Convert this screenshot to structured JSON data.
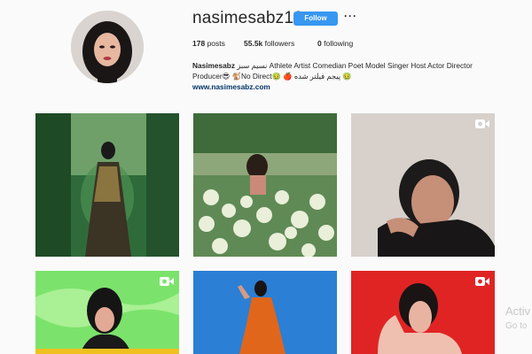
{
  "profile": {
    "username": "nasimesabz13",
    "follow_label": "Follow",
    "more_label": "···",
    "stats": {
      "posts_count": "178",
      "posts_label": "posts",
      "followers_count": "55.5k",
      "followers_label": "followers",
      "following_count": "0",
      "following_label": "following"
    },
    "bio": {
      "name": "Nasimesabz",
      "text_line1": "نسیم سبز Athlete Artist Comedian Poet Model Singer Host Actor Director",
      "text_line2": "Producer😎 🐒No Direct🤢 🍎 پیجم فیلتر شده 🤢",
      "link": "www.nasimesabz.com"
    },
    "accent_color": "#3897f0"
  },
  "grid": {
    "posts": [
      {
        "label": "post-1",
        "is_video": false
      },
      {
        "label": "post-2",
        "is_video": false
      },
      {
        "label": "post-3",
        "is_video": true
      },
      {
        "label": "post-4",
        "is_video": true
      },
      {
        "label": "post-5",
        "is_video": false
      },
      {
        "label": "post-6",
        "is_video": true
      }
    ]
  },
  "watermark": {
    "line1": "Activ",
    "line2": "Go to"
  }
}
